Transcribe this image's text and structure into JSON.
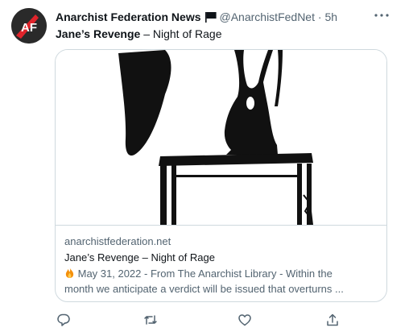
{
  "author": {
    "name": "Anarchist Federation News",
    "handle": "@AnarchistFedNet",
    "separator": "·",
    "time": "5h",
    "avatar_text": "AF",
    "flag_icon": "black-flag-icon"
  },
  "tweet": {
    "title_bold": "Jane’s Revenge",
    "title_rest": " – Night of Rage"
  },
  "card": {
    "domain": "anarchistfederation.net",
    "title": "Jane’s Revenge – Night of Rage",
    "description_emoji": "🔥",
    "description_line1": " May 31, 2022 - From The Anarchist Library - Within the",
    "description_line2": "month we anticipate a verdict will be issued that overturns ..."
  },
  "actions": {
    "reply_icon": "reply-icon",
    "retweet_icon": "retweet-icon",
    "like_icon": "heart-icon",
    "share_icon": "share-icon"
  },
  "colors": {
    "text": "#0f1419",
    "secondary": "#536471",
    "border": "#cfd9de",
    "avatar_bg": "#2a2a2a",
    "avatar_accent": "#e0242b"
  }
}
